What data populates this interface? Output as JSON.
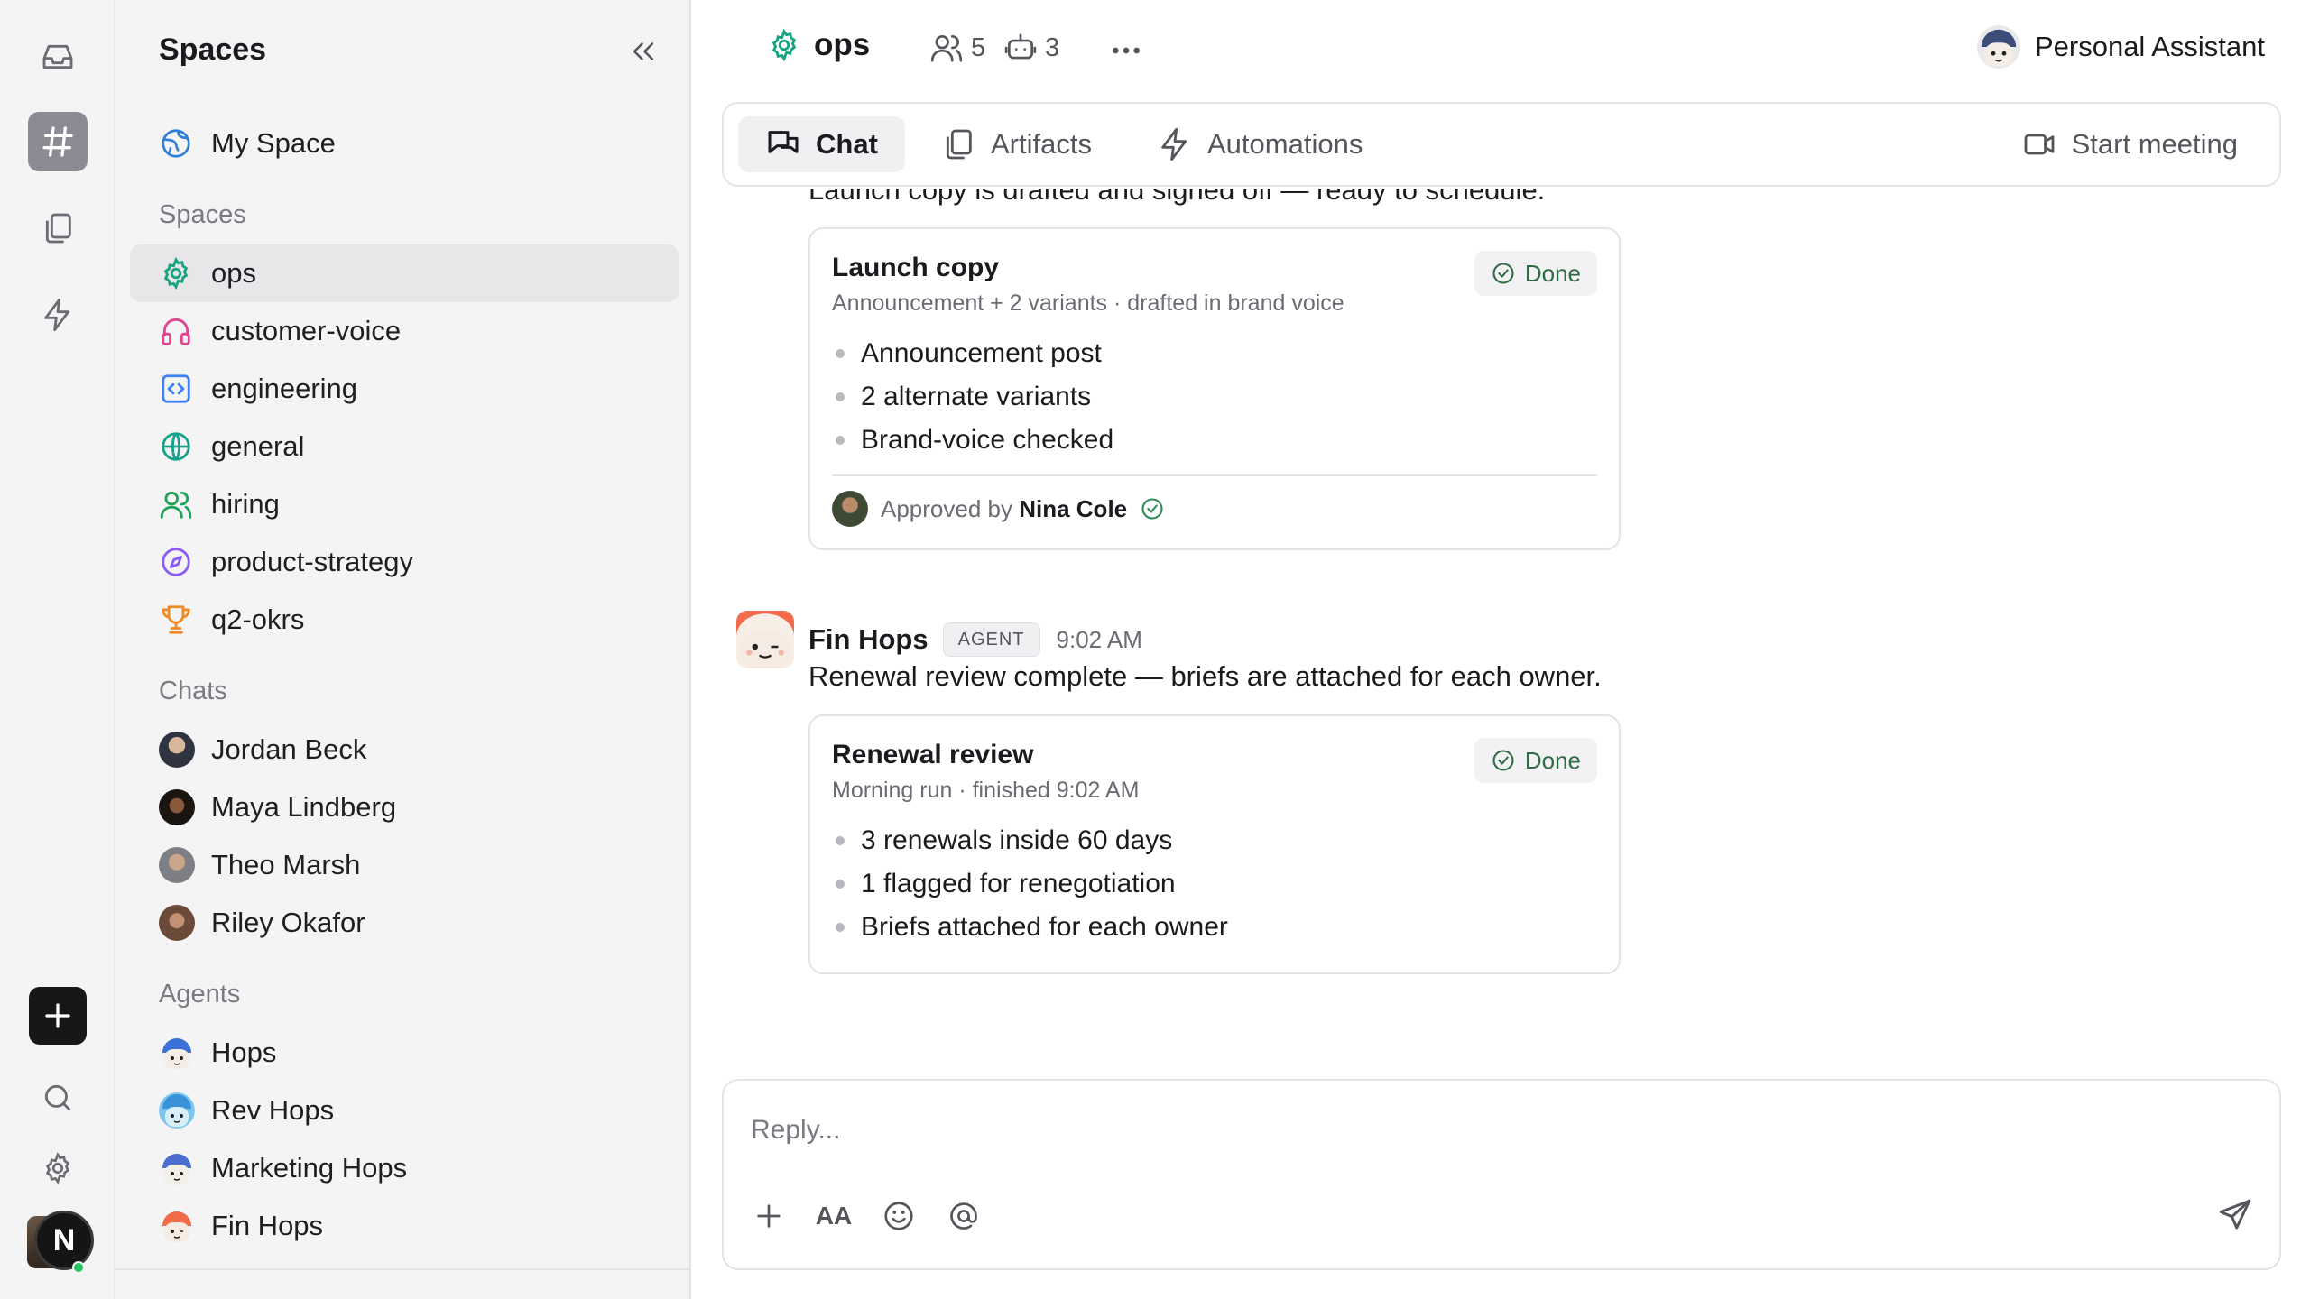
{
  "rail": {
    "items": [
      {
        "icon": "inbox-icon"
      },
      {
        "icon": "hash-icon",
        "active": true
      },
      {
        "icon": "copy-icon"
      },
      {
        "icon": "bolt-icon"
      }
    ],
    "user_initial": "N"
  },
  "sidebar": {
    "title": "Spaces",
    "my_space": "My Space",
    "spaces_header": "Spaces",
    "spaces": [
      {
        "label": "ops",
        "icon": "gear-icon",
        "color": "#16a37f"
      },
      {
        "label": "customer-voice",
        "icon": "headphones-icon",
        "color": "#e0458f"
      },
      {
        "label": "engineering",
        "icon": "code-icon",
        "color": "#3b82f6"
      },
      {
        "label": "general",
        "icon": "globe-icon",
        "color": "#14a38a"
      },
      {
        "label": "hiring",
        "icon": "users-icon",
        "color": "#22a35a"
      },
      {
        "label": "product-strategy",
        "icon": "compass-icon",
        "color": "#8b5cf6"
      },
      {
        "label": "q2-okrs",
        "icon": "trophy-icon",
        "color": "#f08a24"
      }
    ],
    "chats_header": "Chats",
    "chats": [
      {
        "label": "Jordan Beck"
      },
      {
        "label": "Maya Lindberg"
      },
      {
        "label": "Theo Marsh"
      },
      {
        "label": "Riley Okafor"
      }
    ],
    "agents_header": "Agents",
    "agents": [
      {
        "label": "Hops"
      },
      {
        "label": "Rev Hops"
      },
      {
        "label": "Marketing Hops"
      },
      {
        "label": "Fin Hops"
      }
    ]
  },
  "header": {
    "space_name": "ops",
    "members_count": "5",
    "agents_count": "3",
    "assistant_label": "Personal Assistant"
  },
  "tabs": {
    "chat": "Chat",
    "artifacts": "Artifacts",
    "automations": "Automations",
    "start_meeting": "Start meeting"
  },
  "messages": {
    "prev_text": "Launch copy is drafted and signed off — ready to schedule.",
    "launch_card": {
      "title": "Launch copy",
      "subtitle": "Announcement + 2 variants · drafted in brand voice",
      "status": "Done",
      "bullets": [
        "Announcement post",
        "2 alternate variants",
        "Brand-voice checked"
      ],
      "approved_prefix": "Approved by",
      "approved_by": "Nina Cole"
    },
    "fin": {
      "name": "Fin Hops",
      "tag": "AGENT",
      "time": "9:02 AM",
      "text": "Renewal review complete — briefs are attached for each owner.",
      "card": {
        "title": "Renewal review",
        "subtitle": "Morning run · finished 9:02 AM",
        "status": "Done",
        "bullets": [
          "3 renewals inside 60 days",
          "1 flagged for renegotiation",
          "Briefs attached for each owner"
        ]
      }
    }
  },
  "composer": {
    "placeholder": "Reply...",
    "format_label": "AA"
  }
}
